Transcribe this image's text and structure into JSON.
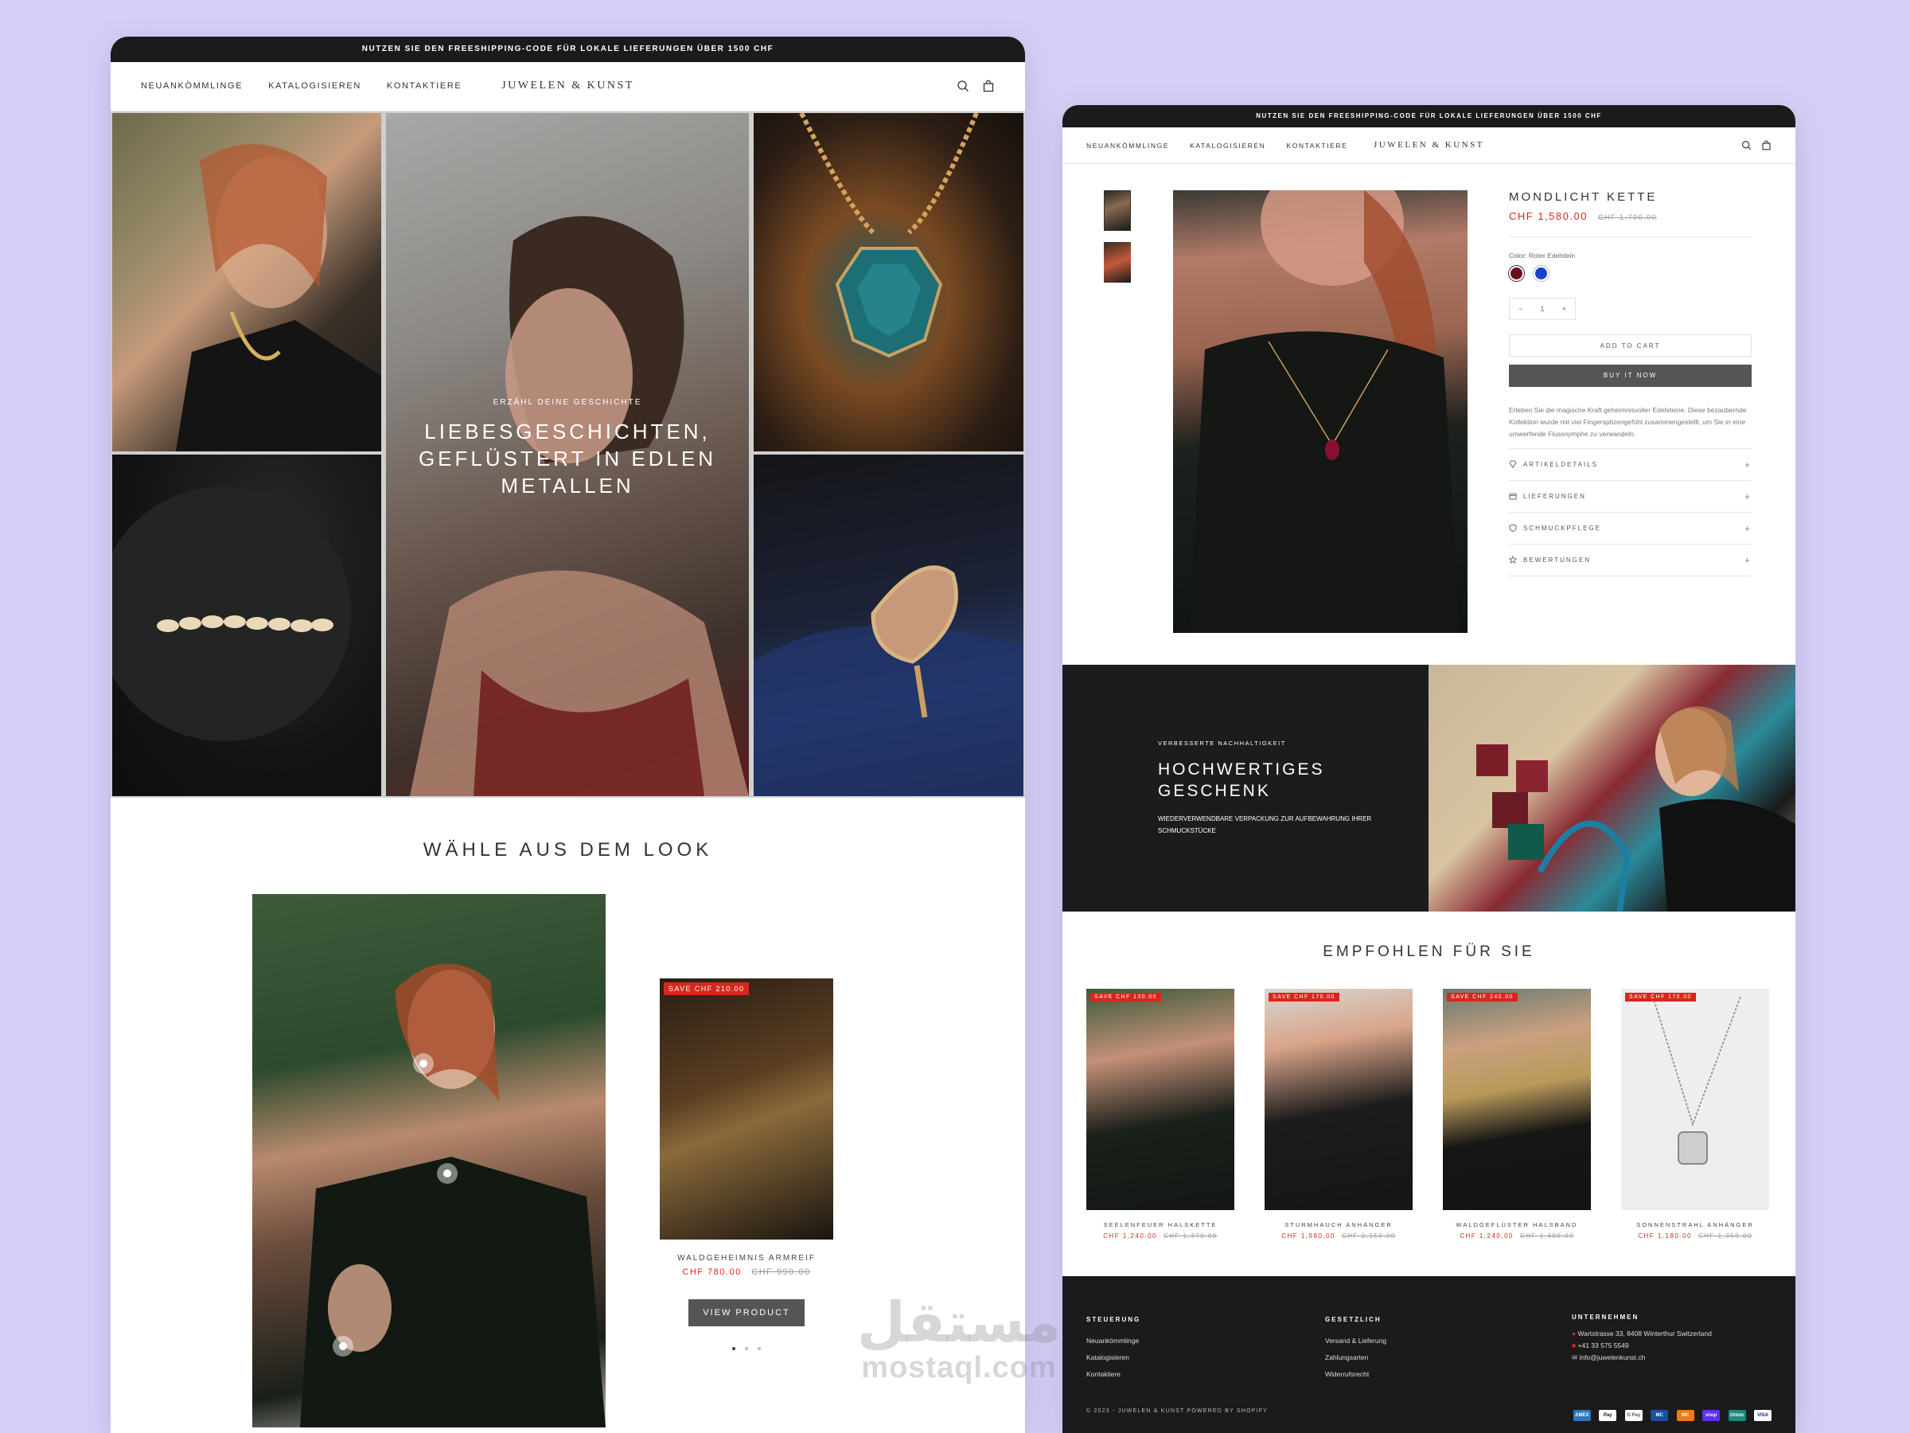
{
  "announcement": "NUTZEN SIE DEN FREESHIPPING-CODE FÜR LOKALE LIEFERUNGEN ÜBER 1500 CHF",
  "nav": {
    "items": [
      "NEUANKÖMMLINGE",
      "KATALOGISIEREN",
      "KONTAKTIERE"
    ],
    "logo": "JUWELEN & KUNST",
    "icons": [
      "search-icon",
      "bag-icon"
    ]
  },
  "hero": {
    "kicker": "ERZÄHL DEINE GESCHICHTE",
    "title": "LIEBESGESCHICHTEN,\nGEFLÜSTERT IN EDLEN\nMETALLEN"
  },
  "look": {
    "title": "WÄHLE AUS DEM LOOK",
    "product": {
      "badge": "SAVE CHF 210.00",
      "name": "WALDGEHEIMNIS ARMREIF",
      "price": "CHF 780.00",
      "old_price": "CHF 990.00",
      "button": "VIEW PRODUCT"
    },
    "slides_total": 3,
    "active_slide": 1
  },
  "product": {
    "title": "MONDLICHT KETTE",
    "price": "CHF 1,580.00",
    "old_price": "CHF 1,700.00",
    "color_label": "Color: Roter Edelstein",
    "swatches": [
      "#6b0f1e",
      "#1a3fd0"
    ],
    "qty_minus": "−",
    "qty_value": "1",
    "qty_plus": "+",
    "add_to_cart": "ADD TO CART",
    "buy_now": "BUY IT NOW",
    "description": "Erleben Sie die magische Kraft geheimnisvoller Edelsteine. Diese bezaubernde Kollektion wurde mit viel Fingerspitzengefühl zusammengestellt, um Sie in eine umwerfende Flussnymphe zu verwandeln.",
    "accordion": [
      {
        "icon": "diamond-icon",
        "label": "ARTIKELDETAILS"
      },
      {
        "icon": "box-icon",
        "label": "LIEFERUNGEN"
      },
      {
        "icon": "shield-icon",
        "label": "SCHMUCKPFLEGE"
      },
      {
        "icon": "star-icon",
        "label": "BEWERTUNGEN"
      }
    ]
  },
  "promo": {
    "kicker": "VERBESSERTE NACHHALTIGKEIT",
    "title": "HOCHWERTIGES\nGESCHENK",
    "text": "WIEDERVERWENDBARE VERPACKUNG ZUR AUFBEWAHRUNG IHRER SCHMUCKSTÜCKE"
  },
  "recommended": {
    "title": "EMPFOHLEN FÜR SIE",
    "items": [
      {
        "badge": "SAVE CHF 130.00",
        "name": "SEELENFEUER HALSKETTE",
        "price": "CHF 1,240.00",
        "old_price": "CHF 1,370.00"
      },
      {
        "badge": "SAVE CHF 170.00",
        "name": "STURMHAUCH ANHÄNGER",
        "price": "CHF 1,980.00",
        "old_price": "CHF 2,150.00"
      },
      {
        "badge": "SAVE CHF 240.00",
        "name": "WALDGEFLÜSTER HALSBAND",
        "price": "CHF 1,240.00",
        "old_price": "CHF 1,480.00"
      },
      {
        "badge": "SAVE CHF 170.00",
        "name": "SONNENSTRAHL ANHÄNGER",
        "price": "CHF 1,180.00",
        "old_price": "CHF 1,350.00"
      }
    ]
  },
  "footer": {
    "col1": {
      "title": "STEUERUNG",
      "links": [
        "Neuankömmlinge",
        "Katalogisieren",
        "Kontaktiere"
      ]
    },
    "col2": {
      "title": "GESETZLICH",
      "links": [
        "Versand & Lieferung",
        "Zahlungsarten",
        "Widerrufsrecht"
      ]
    },
    "col3": {
      "title": "UNTERNEHMEN",
      "lines": [
        "Wartstrasse 33, 8408 Winterthur Switzerland",
        "+41 33 575 5549",
        "info@juwelenkunst.ch"
      ]
    },
    "copyright": "© 2023 - JUWELEN & KUNST POWERED BY SHOPIFY",
    "payments": [
      "AMEX",
      "Pay",
      "G Pay",
      "MC",
      "MC",
      "shop",
      "Union",
      "VISA"
    ]
  },
  "watermark": {
    "arabic": "مستقل",
    "latin": "mostaql.com"
  },
  "colors": {
    "accent": "#d9261c",
    "dark": "#1b1b1b",
    "background": "#d6d0f7"
  }
}
